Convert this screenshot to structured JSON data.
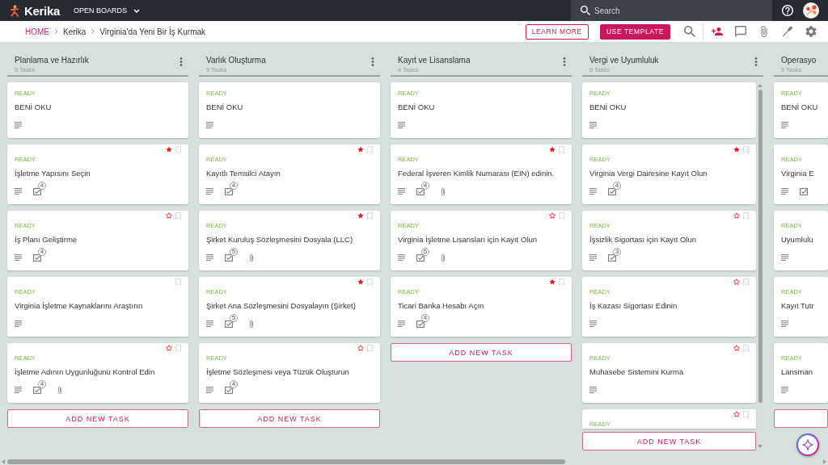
{
  "topbar": {
    "logo": "Kerika",
    "boards_menu": "OPEN BOARDS",
    "search": {
      "placeholder": "Search"
    }
  },
  "breadcrumb": [
    {
      "label": "HOME",
      "kind": "home"
    },
    {
      "label": "Kerika",
      "kind": "link"
    },
    {
      "label": "Virginia'da Yeni Bir İş Kurmak",
      "kind": "current"
    }
  ],
  "actions": [
    {
      "label": "LEARN MORE",
      "kind": "outline"
    },
    {
      "label": "USE TEMPLATE",
      "kind": "filled"
    }
  ],
  "columns": [
    {
      "title": "Planlama ve Hazırlık",
      "count": "5 Tasks",
      "menu": true,
      "cards": [
        {
          "kind": "readme",
          "status": "READY",
          "title": "BENİ OKU",
          "description": true
        },
        {
          "kind": "task",
          "starred": true,
          "bookmarked": false,
          "status": "READY",
          "title": "İşletme Yapısını Seçin",
          "description": true,
          "checklist": true,
          "checklist_count": "4"
        },
        {
          "kind": "task",
          "starred": false,
          "bookmarked": false,
          "status": "READY",
          "title": "İş Planı Geliştirme",
          "description": true,
          "checklist": true,
          "checklist_count": "4"
        },
        {
          "kind": "task",
          "bookmarked": false,
          "status": "READY",
          "title": "Virginia İşletme Kaynaklarını Araştırın",
          "description": true
        },
        {
          "kind": "task",
          "starred": false,
          "bookmarked": false,
          "status": "READY",
          "title": "İşletme Adının Uygunluğunu Kontrol Edin",
          "description": true,
          "checklist": true,
          "checklist_count": "4",
          "attachment": true
        }
      ],
      "add_button": true,
      "add_label": "ADD NEW TASK"
    },
    {
      "title": "Varlık Oluşturma",
      "count": "5 Tasks",
      "menu": true,
      "cards": [
        {
          "kind": "readme",
          "status": "READY",
          "title": "BENİ OKU",
          "description": true
        },
        {
          "kind": "task",
          "starred": true,
          "bookmarked": false,
          "status": "READY",
          "title": "Kayıtlı Temsilci Atayın",
          "description": true,
          "checklist": true,
          "checklist_count": "4"
        },
        {
          "kind": "task",
          "starred": true,
          "bookmarked": false,
          "status": "READY",
          "title": "Şirket Kuruluş Sözleşmesini Dosyala (LLC)",
          "description": true,
          "checklist": true,
          "checklist_count": "5",
          "attachment": true
        },
        {
          "kind": "task",
          "starred": true,
          "bookmarked": false,
          "status": "READY",
          "title": "Şirket Ana Sözleşmesini Dosyalayın (Şirket)",
          "description": true,
          "checklist": true,
          "checklist_count": "5",
          "attachment": true
        },
        {
          "kind": "task",
          "starred": false,
          "bookmarked": false,
          "status": "READY",
          "title": "İşletme Sözleşmesi veya Tüzük Oluşturun",
          "description": true,
          "checklist": true,
          "checklist_count": "4"
        }
      ],
      "add_button": true,
      "add_label": "ADD NEW TASK"
    },
    {
      "title": "Kayıt ve Lisanslama",
      "count": "4 Tasks",
      "menu": true,
      "cards": [
        {
          "kind": "readme",
          "status": "READY",
          "title": "BENİ OKU",
          "description": true
        },
        {
          "kind": "task",
          "starred": true,
          "bookmarked": false,
          "status": "READY",
          "title": "Federal İşveren Kimlik Numarası (EIN) edinin.",
          "description": true,
          "checklist": true,
          "checklist_count": "4",
          "attachment": true
        },
        {
          "kind": "task",
          "starred": false,
          "bookmarked": false,
          "status": "READY",
          "title": "Virginia İşletme Lisansları için Kayıt Olun",
          "description": true,
          "checklist": true,
          "checklist_count": "5",
          "attachment": true
        },
        {
          "kind": "task",
          "starred": true,
          "bookmarked": false,
          "status": "READY",
          "title": "Ticari Banka Hesabı Açın",
          "description": true,
          "checklist": true,
          "checklist_count": "4"
        }
      ],
      "add_button": true,
      "add_label": "ADD NEW TASK"
    },
    {
      "title": "Vergi ve Uyumluluk",
      "count": "6 Tasks",
      "menu": true,
      "cards": [
        {
          "kind": "readme",
          "status": "READY",
          "title": "BENİ OKU",
          "description": true
        },
        {
          "kind": "task",
          "starred": true,
          "bookmarked": false,
          "status": "READY",
          "title": "Virginia Vergi Dairesine Kayıt Olun",
          "description": true,
          "checklist": true,
          "checklist_count": "4"
        },
        {
          "kind": "task",
          "starred": false,
          "bookmarked": false,
          "status": "READY",
          "title": "İşsizlik Sigortası için Kayıt Olun",
          "description": true,
          "checklist": true,
          "checklist_count": "3"
        },
        {
          "kind": "task",
          "starred": false,
          "bookmarked": false,
          "status": "READY",
          "title": "İş Kazası Sigortası Edinin",
          "description": true
        },
        {
          "kind": "task",
          "starred": false,
          "bookmarked": false,
          "status": "READY",
          "title": "Muhasebe Sistemini Kurma",
          "description": true
        },
        {
          "kind": "cut",
          "starred": false,
          "bookmarked": false,
          "status": "READY"
        }
      ],
      "add_button": true,
      "add_label": "ADD NEW TASK"
    },
    {
      "title": "Operasyo",
      "count": "5 Tasks",
      "cards": [
        {
          "kind": "readme",
          "status": "READY",
          "title": "BENİ OKU",
          "description": true
        },
        {
          "kind": "task",
          "status": "READY",
          "title": "Virginia E",
          "description": true,
          "checklist": true
        },
        {
          "kind": "task",
          "status": "READY",
          "title": "Uyumlulu",
          "description": true
        },
        {
          "kind": "task",
          "status": "READY",
          "title": "Kayıt Tutr",
          "description": true
        },
        {
          "kind": "task",
          "status": "READY",
          "title": "Lansman",
          "description": true
        }
      ],
      "add_button": true
    }
  ]
}
